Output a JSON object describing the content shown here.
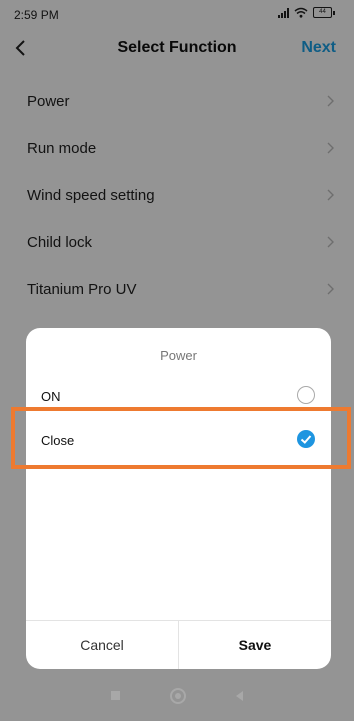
{
  "status_bar": {
    "time": "2:59 PM",
    "battery": "44"
  },
  "header": {
    "title": "Select Function",
    "next_label": "Next"
  },
  "list": {
    "items": [
      {
        "label": "Power"
      },
      {
        "label": "Run mode"
      },
      {
        "label": "Wind speed setting"
      },
      {
        "label": "Child lock"
      },
      {
        "label": "Titanium Pro UV"
      }
    ]
  },
  "dialog": {
    "title": "Power",
    "options": [
      {
        "label": "ON",
        "selected": false
      },
      {
        "label": "Close",
        "selected": true
      }
    ],
    "cancel_label": "Cancel",
    "save_label": "Save"
  },
  "colors": {
    "accent": "#1aa0e6",
    "radio_selected": "#1e95e0",
    "highlight": "#ee7a30"
  }
}
